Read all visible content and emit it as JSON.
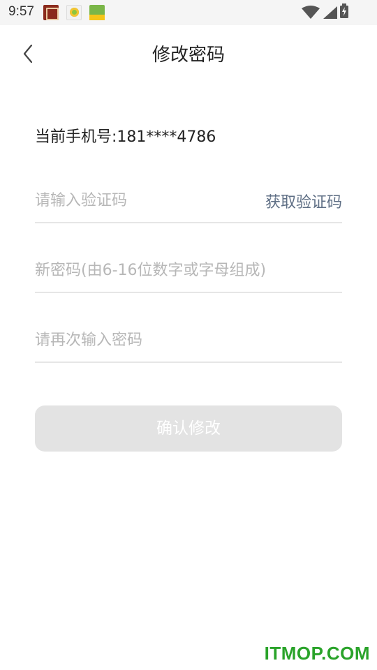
{
  "status_bar": {
    "time": "9:57",
    "notification_icons": [
      "app-notification-icon-1",
      "app-notification-icon-2",
      "app-notification-icon-3"
    ],
    "system_icons": [
      "wifi-icon",
      "signal-icon",
      "battery-charging-icon"
    ]
  },
  "header": {
    "title": "修改密码",
    "back_icon": "chevron-left-icon"
  },
  "account": {
    "phone_label": "当前手机号:181****4786"
  },
  "form": {
    "code_placeholder": "请输入验证码",
    "get_code_label": "获取验证码",
    "new_password_placeholder": "新密码(由6-16位数字或字母组成)",
    "confirm_password_placeholder": "请再次输入密码",
    "submit_label": "确认修改"
  },
  "colors": {
    "link": "#5f6f85",
    "disabled_button": "#e3e3e3",
    "divider": "#e6e6e6",
    "watermark": "#2aa32a"
  },
  "watermark": {
    "text": "ITMOP.COM"
  }
}
